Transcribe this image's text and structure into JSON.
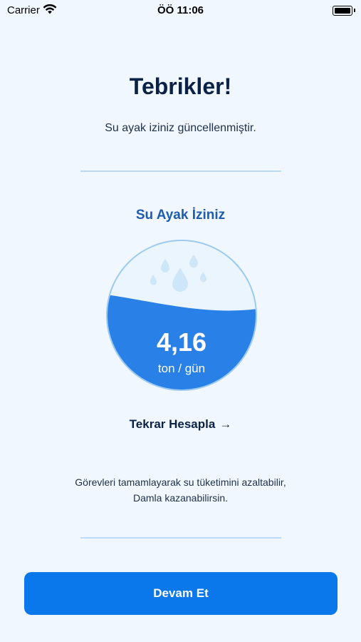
{
  "status_bar": {
    "carrier": "Carrier",
    "time": "ÖÖ 11:06"
  },
  "header": {
    "title": "Tebrikler!",
    "subtitle": "Su ayak iziniz güncellenmiştir."
  },
  "footprint": {
    "section_title": "Su Ayak İziniz",
    "value": "4,16",
    "unit": "ton / gün",
    "fill_level_fraction": 0.58,
    "fill_color": "#2980E6",
    "empty_color": "#EAF5FD"
  },
  "actions": {
    "recalculate_label": "Tekrar Hesapla",
    "continue_label": "Devam Et"
  },
  "info": {
    "line1": "Görevleri tamamlayarak su tüketimini azaltabilir,",
    "line2": "Damla kazanabilirsin."
  },
  "colors": {
    "background": "#F1F7FE",
    "primary": "#0A78EB",
    "title": "#0B2246",
    "accent": "#1E5CAD",
    "divider": "#BBDCF8"
  }
}
